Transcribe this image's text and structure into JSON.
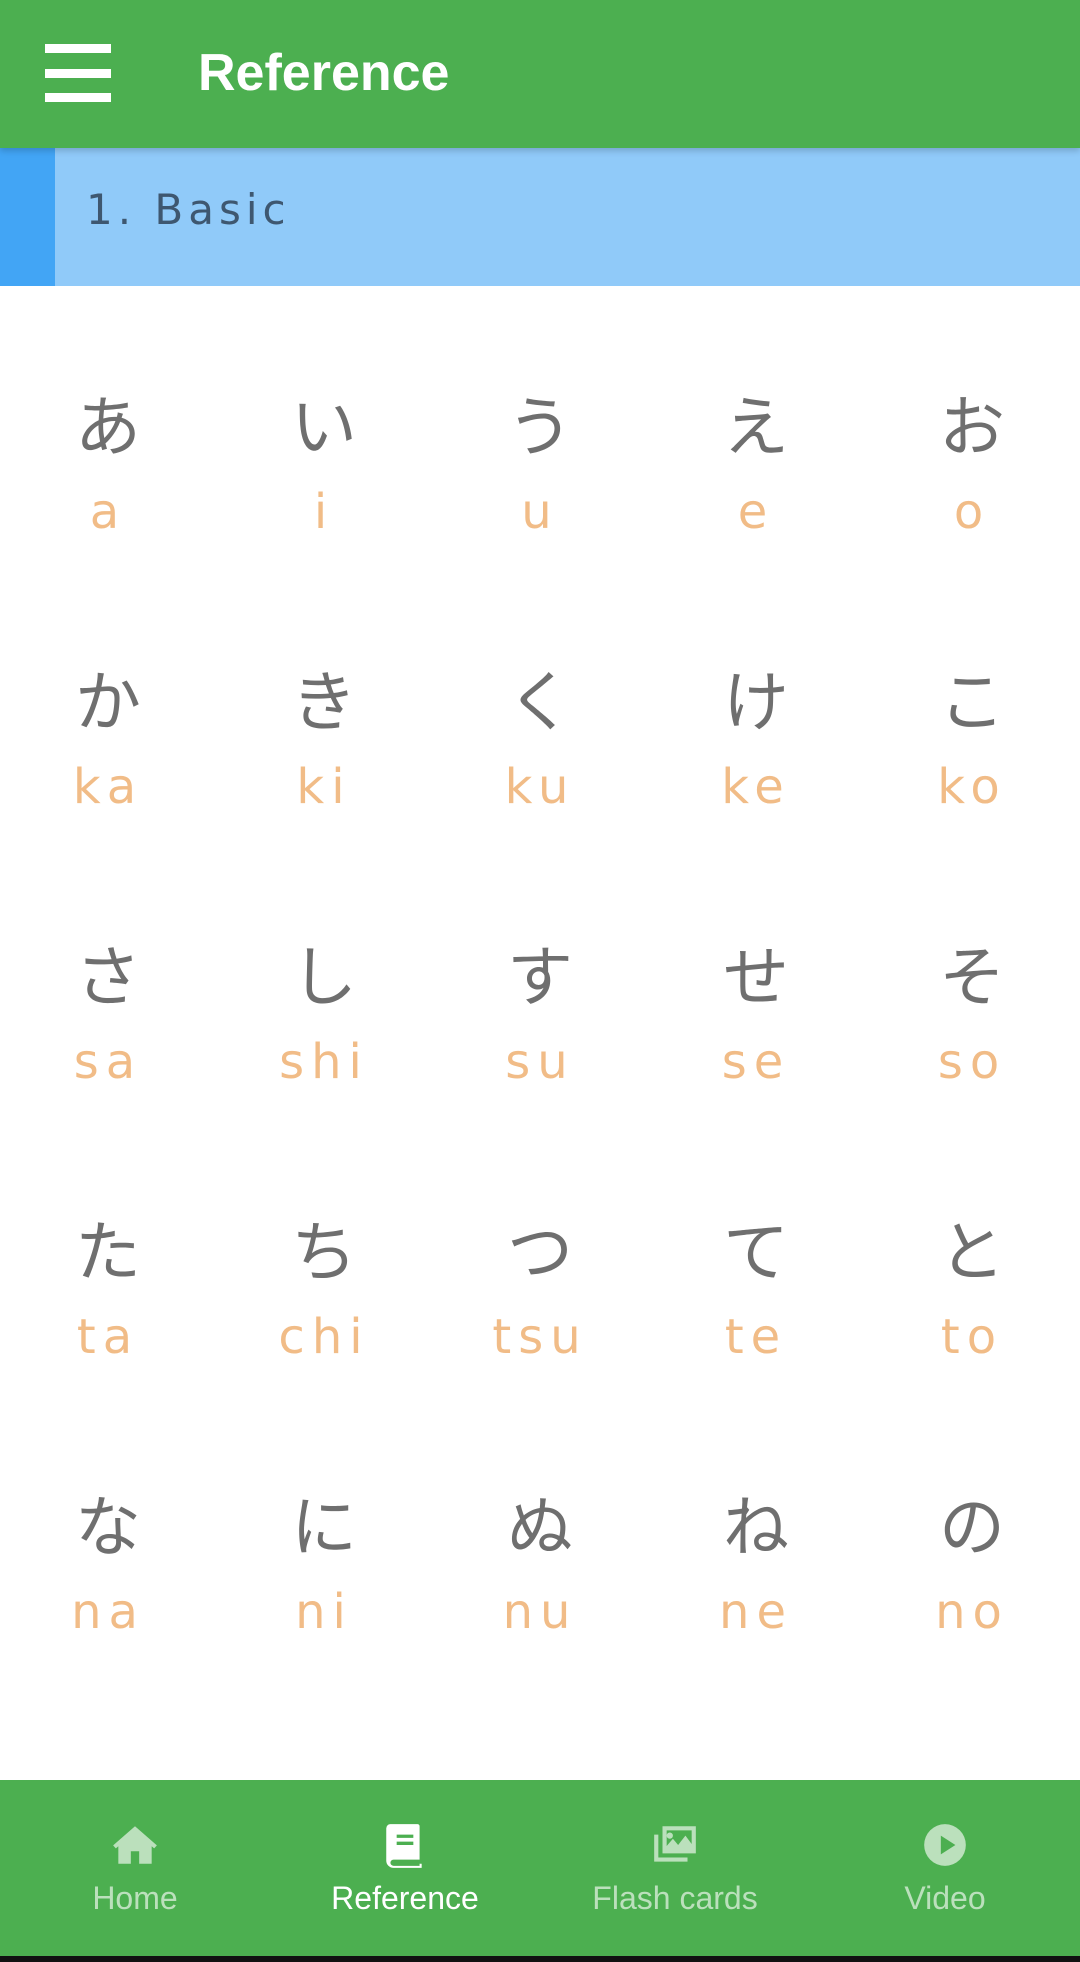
{
  "appbar": {
    "title": "Reference",
    "menu_icon": "hamburger-menu-icon",
    "background": "#4caf50"
  },
  "section": {
    "title": "1. Basic",
    "background": "#90caf9",
    "accent": "#42a5f5"
  },
  "kana_rows": [
    [
      {
        "kana": "あ",
        "romaji": "a"
      },
      {
        "kana": "い",
        "romaji": "i"
      },
      {
        "kana": "う",
        "romaji": "u"
      },
      {
        "kana": "え",
        "romaji": "e"
      },
      {
        "kana": "お",
        "romaji": "o"
      }
    ],
    [
      {
        "kana": "か",
        "romaji": "ka"
      },
      {
        "kana": "き",
        "romaji": "ki"
      },
      {
        "kana": "く",
        "romaji": "ku"
      },
      {
        "kana": "け",
        "romaji": "ke"
      },
      {
        "kana": "こ",
        "romaji": "ko"
      }
    ],
    [
      {
        "kana": "さ",
        "romaji": "sa"
      },
      {
        "kana": "し",
        "romaji": "shi"
      },
      {
        "kana": "す",
        "romaji": "su"
      },
      {
        "kana": "せ",
        "romaji": "se"
      },
      {
        "kana": "そ",
        "romaji": "so"
      }
    ],
    [
      {
        "kana": "た",
        "romaji": "ta"
      },
      {
        "kana": "ち",
        "romaji": "chi"
      },
      {
        "kana": "つ",
        "romaji": "tsu"
      },
      {
        "kana": "て",
        "romaji": "te"
      },
      {
        "kana": "と",
        "romaji": "to"
      }
    ],
    [
      {
        "kana": "な",
        "romaji": "na"
      },
      {
        "kana": "に",
        "romaji": "ni"
      },
      {
        "kana": "ぬ",
        "romaji": "nu"
      },
      {
        "kana": "ね",
        "romaji": "ne"
      },
      {
        "kana": "の",
        "romaji": "no"
      }
    ]
  ],
  "colors": {
    "kana": "#6f6f6f",
    "romaji": "#f1bc87"
  },
  "bottom_nav": {
    "items": [
      {
        "label": "Home",
        "icon": "home-icon",
        "active": false
      },
      {
        "label": "Reference",
        "icon": "book-icon",
        "active": true
      },
      {
        "label": "Flash cards",
        "icon": "images-icon",
        "active": false
      },
      {
        "label": "Video",
        "icon": "play-circle-icon",
        "active": false
      }
    ]
  }
}
